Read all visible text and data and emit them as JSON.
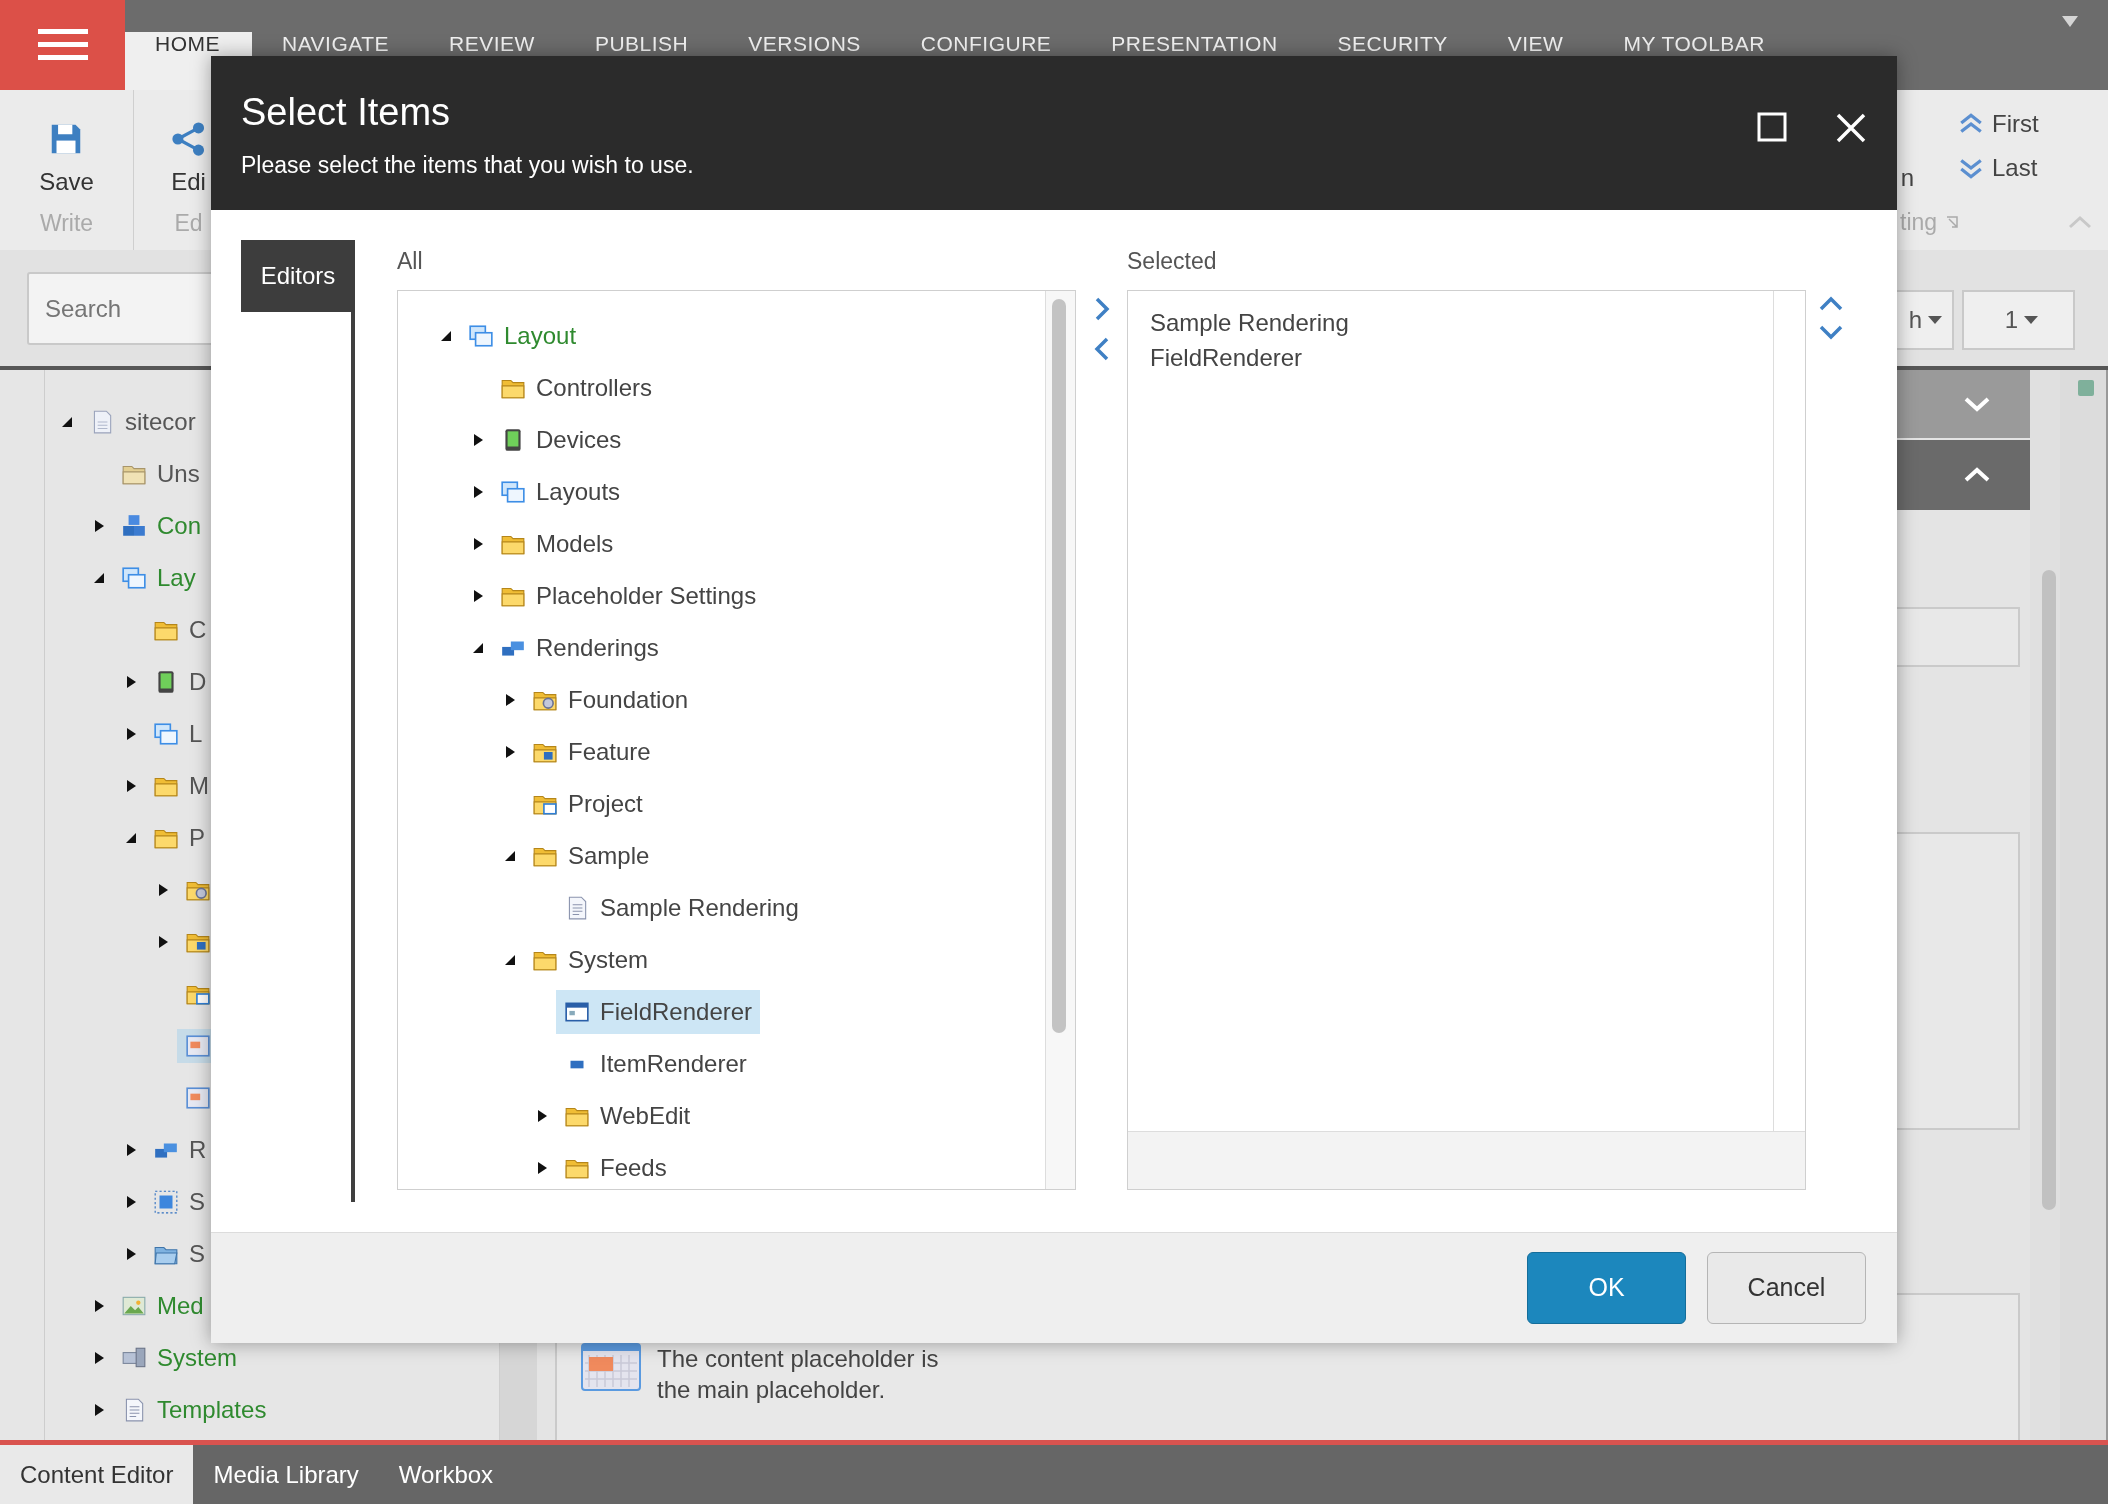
{
  "app": {
    "ribbon_tabs": [
      {
        "label": "HOME",
        "selected": true
      },
      {
        "label": "NAVIGATE",
        "selected": false
      },
      {
        "label": "REVIEW",
        "selected": false
      },
      {
        "label": "PUBLISH",
        "selected": false
      },
      {
        "label": "VERSIONS",
        "selected": false
      },
      {
        "label": "CONFIGURE",
        "selected": false
      },
      {
        "label": "PRESENTATION",
        "selected": false
      },
      {
        "label": "SECURITY",
        "selected": false
      },
      {
        "label": "VIEW",
        "selected": false
      },
      {
        "label": "MY TOOLBAR",
        "selected": false
      }
    ],
    "ribbon_groups": [
      {
        "button": "Save",
        "label": "Write",
        "kind": "save"
      },
      {
        "button": "Edi",
        "label": "Ed",
        "kind": "share"
      }
    ],
    "ribbon_right": {
      "button": "n",
      "label": "ting",
      "nav": [
        {
          "label": "First",
          "kind": "up"
        },
        {
          "label": "Last",
          "kind": "down"
        }
      ]
    },
    "search": {
      "placeholder": "Search"
    },
    "dropdowns": [
      "h",
      "1"
    ],
    "tree": [
      {
        "label": "sitecor",
        "kind": "page",
        "color": "#555555",
        "expanded": true,
        "selected": false,
        "children": [
          {
            "label": "Uns",
            "kind": "folder-pale",
            "color": "#555555",
            "selected": false
          },
          {
            "label": "Con",
            "kind": "cubes",
            "color": "#2f8a2f",
            "expanded": false,
            "selected": false
          },
          {
            "label": "Lay",
            "kind": "layout",
            "color": "#2f8a2f",
            "expanded": true,
            "selected": false,
            "children": [
              {
                "label": "C",
                "kind": "folder",
                "color": "#555555",
                "selected": false
              },
              {
                "label": "D",
                "kind": "device",
                "color": "#555555",
                "expanded": false,
                "selected": false
              },
              {
                "label": "L",
                "kind": "layout",
                "color": "#555555",
                "expanded": false,
                "selected": false
              },
              {
                "label": "M",
                "kind": "folder",
                "color": "#555555",
                "expanded": false,
                "selected": false
              },
              {
                "label": "P",
                "kind": "folder",
                "color": "#555555",
                "expanded": true,
                "selected": false,
                "children": [
                  {
                    "kind": "folder-gear",
                    "expanded": false,
                    "selected": false
                  },
                  {
                    "kind": "folder-badge",
                    "expanded": false,
                    "selected": false
                  },
                  {
                    "kind": "folder-window",
                    "selected": false
                  },
                  {
                    "kind": "grid",
                    "selected": true
                  },
                  {
                    "kind": "grid",
                    "selected": false
                  }
                ]
              },
              {
                "label": "R",
                "kind": "renderings",
                "color": "#555555",
                "expanded": false,
                "selected": false
              },
              {
                "label": "S",
                "kind": "dashed",
                "color": "#555555",
                "expanded": false,
                "selected": false
              },
              {
                "label": "S",
                "kind": "folder-blue",
                "color": "#555555",
                "expanded": false,
                "selected": false
              }
            ]
          },
          {
            "label": "Med",
            "kind": "media",
            "color": "#2f8a2f",
            "expanded": false,
            "selected": false
          },
          {
            "label": "System",
            "kind": "system",
            "color": "#2f8a2f",
            "expanded": false,
            "selected": false
          },
          {
            "label": "Templates",
            "kind": "doc",
            "color": "#2f8a2f",
            "expanded": false,
            "selected": false
          }
        ]
      }
    ],
    "content_text": "The content placeholder is the main placeholder.",
    "bottom_tabs": [
      {
        "label": "Content Editor",
        "selected": true
      },
      {
        "label": "Media Library",
        "selected": false
      },
      {
        "label": "Workbox",
        "selected": false
      }
    ]
  },
  "dialog": {
    "title": "Select Items",
    "subtitle": "Please select the items that you wish to use.",
    "side_tabs": [
      {
        "label": "Editors",
        "selected": true
      }
    ],
    "all_label": "All",
    "selected_label": "Selected",
    "tree": [
      {
        "label": "Layout",
        "kind": "layout",
        "color": "#2f8a2f",
        "expanded": true,
        "selected": false,
        "children": [
          {
            "label": "Controllers",
            "kind": "folder",
            "color": "#444444",
            "selected": false
          },
          {
            "label": "Devices",
            "kind": "device",
            "color": "#444444",
            "expanded": false,
            "selected": false
          },
          {
            "label": "Layouts",
            "kind": "layout",
            "color": "#444444",
            "expanded": false,
            "selected": false
          },
          {
            "label": "Models",
            "kind": "folder",
            "color": "#444444",
            "expanded": false,
            "selected": false
          },
          {
            "label": "Placeholder Settings",
            "kind": "folder",
            "color": "#444444",
            "expanded": false,
            "selected": false
          },
          {
            "label": "Renderings",
            "kind": "renderings",
            "color": "#444444",
            "expanded": true,
            "selected": false,
            "children": [
              {
                "label": "Foundation",
                "kind": "folder-gear",
                "color": "#444444",
                "expanded": false,
                "selected": false
              },
              {
                "label": "Feature",
                "kind": "folder-badge",
                "color": "#444444",
                "expanded": false,
                "selected": false
              },
              {
                "label": "Project",
                "kind": "folder-window",
                "color": "#444444",
                "selected": false
              },
              {
                "label": "Sample",
                "kind": "folder",
                "color": "#444444",
                "expanded": true,
                "selected": false,
                "children": [
                  {
                    "label": "Sample Rendering",
                    "kind": "doc",
                    "color": "#444444",
                    "selected": false
                  }
                ]
              },
              {
                "label": "System",
                "kind": "folder",
                "color": "#444444",
                "expanded": true,
                "selected": false,
                "children": [
                  {
                    "label": "FieldRenderer",
                    "kind": "window",
                    "color": "#444444",
                    "selected": true
                  },
                  {
                    "label": "ItemRenderer",
                    "kind": "block",
                    "color": "#444444",
                    "selected": false
                  },
                  {
                    "label": "WebEdit",
                    "kind": "folder",
                    "color": "#444444",
                    "expanded": false,
                    "selected": false
                  },
                  {
                    "label": "Feeds",
                    "kind": "folder",
                    "color": "#444444",
                    "expanded": false,
                    "selected": false
                  }
                ]
              }
            ]
          }
        ]
      }
    ],
    "selected_items": [
      {
        "label": "Sample Rendering",
        "selected": false
      },
      {
        "label": "FieldRenderer",
        "selected": false
      }
    ],
    "buttons": [
      {
        "label": "OK",
        "kind": "primary"
      },
      {
        "label": "Cancel",
        "kind": "secondary"
      }
    ]
  }
}
